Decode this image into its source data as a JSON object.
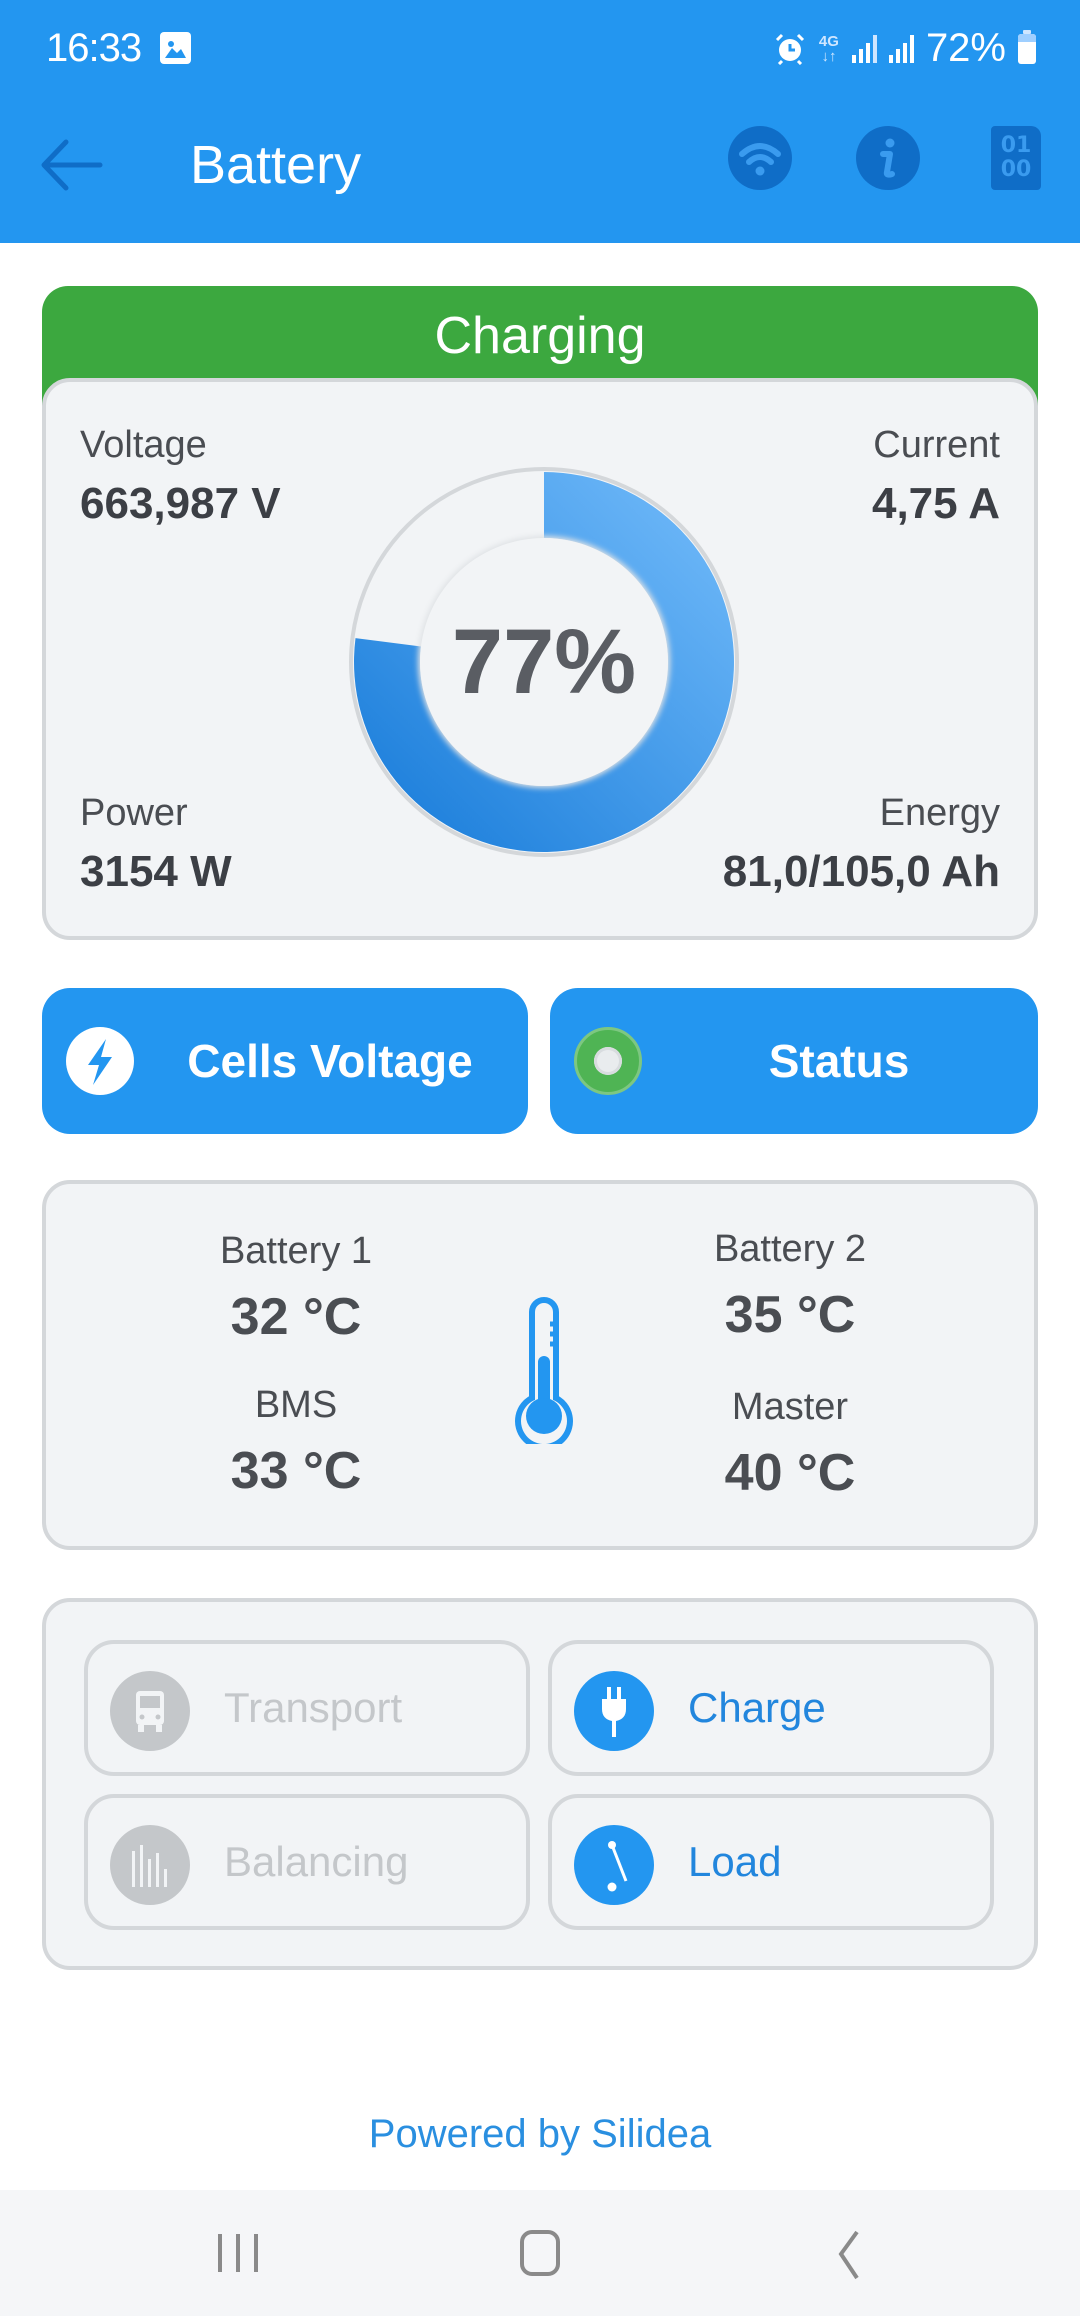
{
  "status_bar": {
    "time": "16:33",
    "network": "4G",
    "battery_percent": "72%",
    "icons": [
      "gallery-icon",
      "alarm-icon",
      "4g-data-icon",
      "signal-icon",
      "signal-icon",
      "battery-icon"
    ]
  },
  "toolbar": {
    "title": "Battery",
    "back_icon": "arrow-left-icon",
    "actions": [
      "wifi-icon",
      "info-icon",
      "binary-data-icon"
    ]
  },
  "battery_state": {
    "label": "Charging",
    "color": "#3ca83f"
  },
  "metrics": {
    "voltage": {
      "label": "Voltage",
      "value": "663,987 V"
    },
    "current": {
      "label": "Current",
      "value": "4,75 A"
    },
    "power": {
      "label": "Power",
      "value": "3154 W"
    },
    "energy": {
      "label": "Energy",
      "value": "81,0/105,0 Ah"
    }
  },
  "gauge": {
    "percent_label": "77%",
    "state_of_charge": 0.77,
    "colors": {
      "start": "#1479d8",
      "end": "#75bdfb"
    }
  },
  "actions": {
    "cells_voltage": {
      "label": "Cells Voltage",
      "icon": "lightning-bolt-icon"
    },
    "status": {
      "label": "Status",
      "icon": "status-led-icon",
      "led_color": "#4fb454"
    }
  },
  "temperatures": {
    "battery1": {
      "label": "Battery 1",
      "value": "32 °C"
    },
    "battery2": {
      "label": "Battery 2",
      "value": "35 °C"
    },
    "bms": {
      "label": "BMS",
      "value": "33 °C"
    },
    "master": {
      "label": "Master",
      "value": "40 °C"
    }
  },
  "modes": [
    {
      "label": "Transport",
      "icon": "bus-icon",
      "active": false
    },
    {
      "label": "Charge",
      "icon": "plug-icon",
      "active": true
    },
    {
      "label": "Balancing",
      "icon": "bars-icon",
      "active": false
    },
    {
      "label": "Load",
      "icon": "switch-icon",
      "active": true
    }
  ],
  "footer": {
    "text": "Powered by Silidea"
  },
  "colors": {
    "primary": "#2396f0",
    "toolbar_icon_bg": "#0f6dc7",
    "card_bg": "#f2f4f6",
    "card_border": "#d4d7da",
    "inactive": "#c4c7ca"
  }
}
